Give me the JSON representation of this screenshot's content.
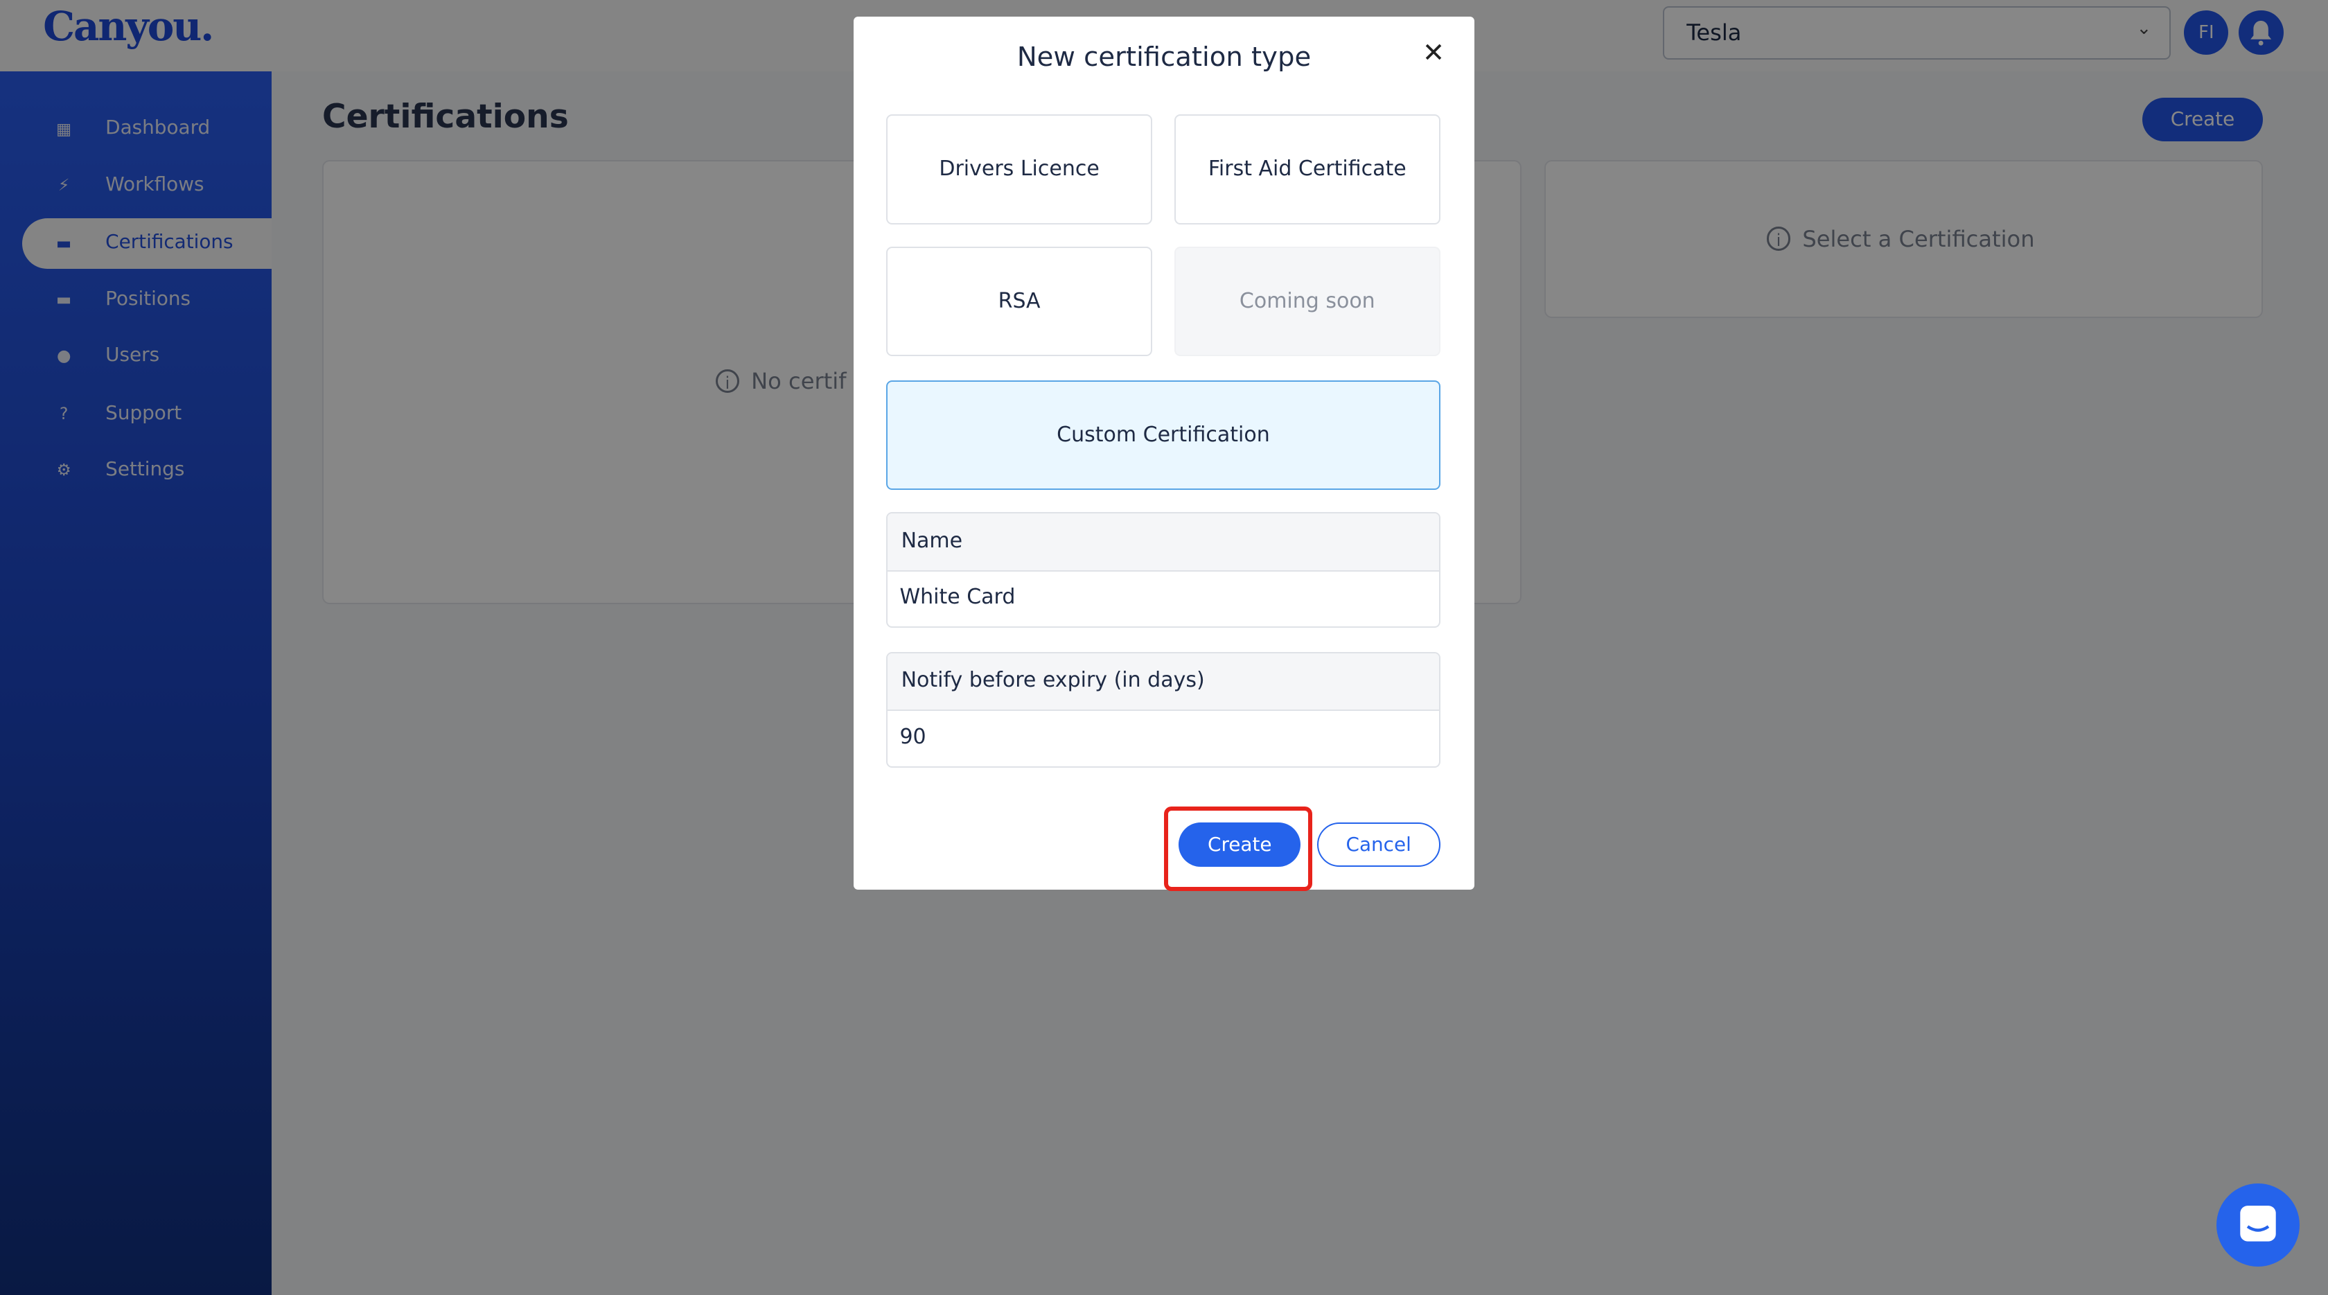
{
  "app": {
    "logo": "Canyou.",
    "org_selector": "Tesla",
    "avatar_initials": "FI"
  },
  "sidebar": {
    "items": [
      {
        "label": "Dashboard",
        "icon": "dashboard-icon",
        "glyph": "▦"
      },
      {
        "label": "Workflows",
        "icon": "bolt-icon",
        "glyph": "⚡"
      },
      {
        "label": "Certifications",
        "icon": "briefcase-icon",
        "glyph": "▬",
        "active": true
      },
      {
        "label": "Positions",
        "icon": "briefcase-icon",
        "glyph": "▬"
      },
      {
        "label": "Users",
        "icon": "user-icon",
        "glyph": "●"
      },
      {
        "label": "Support",
        "icon": "support-icon",
        "glyph": "?"
      },
      {
        "label": "Settings",
        "icon": "gear-icon",
        "glyph": "⚙"
      }
    ]
  },
  "main": {
    "title": "Certifications",
    "create_label": "Create",
    "empty_list": "No certif",
    "empty_detail": "Select a Certification"
  },
  "modal": {
    "title": "New certification type",
    "options": [
      {
        "label": "Drivers Licence"
      },
      {
        "label": "First Aid Certificate"
      },
      {
        "label": "RSA"
      },
      {
        "label": "Coming soon",
        "disabled": true
      },
      {
        "label": "Custom Certification",
        "selected": true
      }
    ],
    "name_label": "Name",
    "name_value": "White Card",
    "notify_label": "Notify before expiry (in days)",
    "notify_value": "90",
    "create_label": "Create",
    "cancel_label": "Cancel"
  },
  "colors": {
    "accent": "#2563eb",
    "highlight": "#e8231b",
    "selected_bg": "#eaf7ff"
  }
}
